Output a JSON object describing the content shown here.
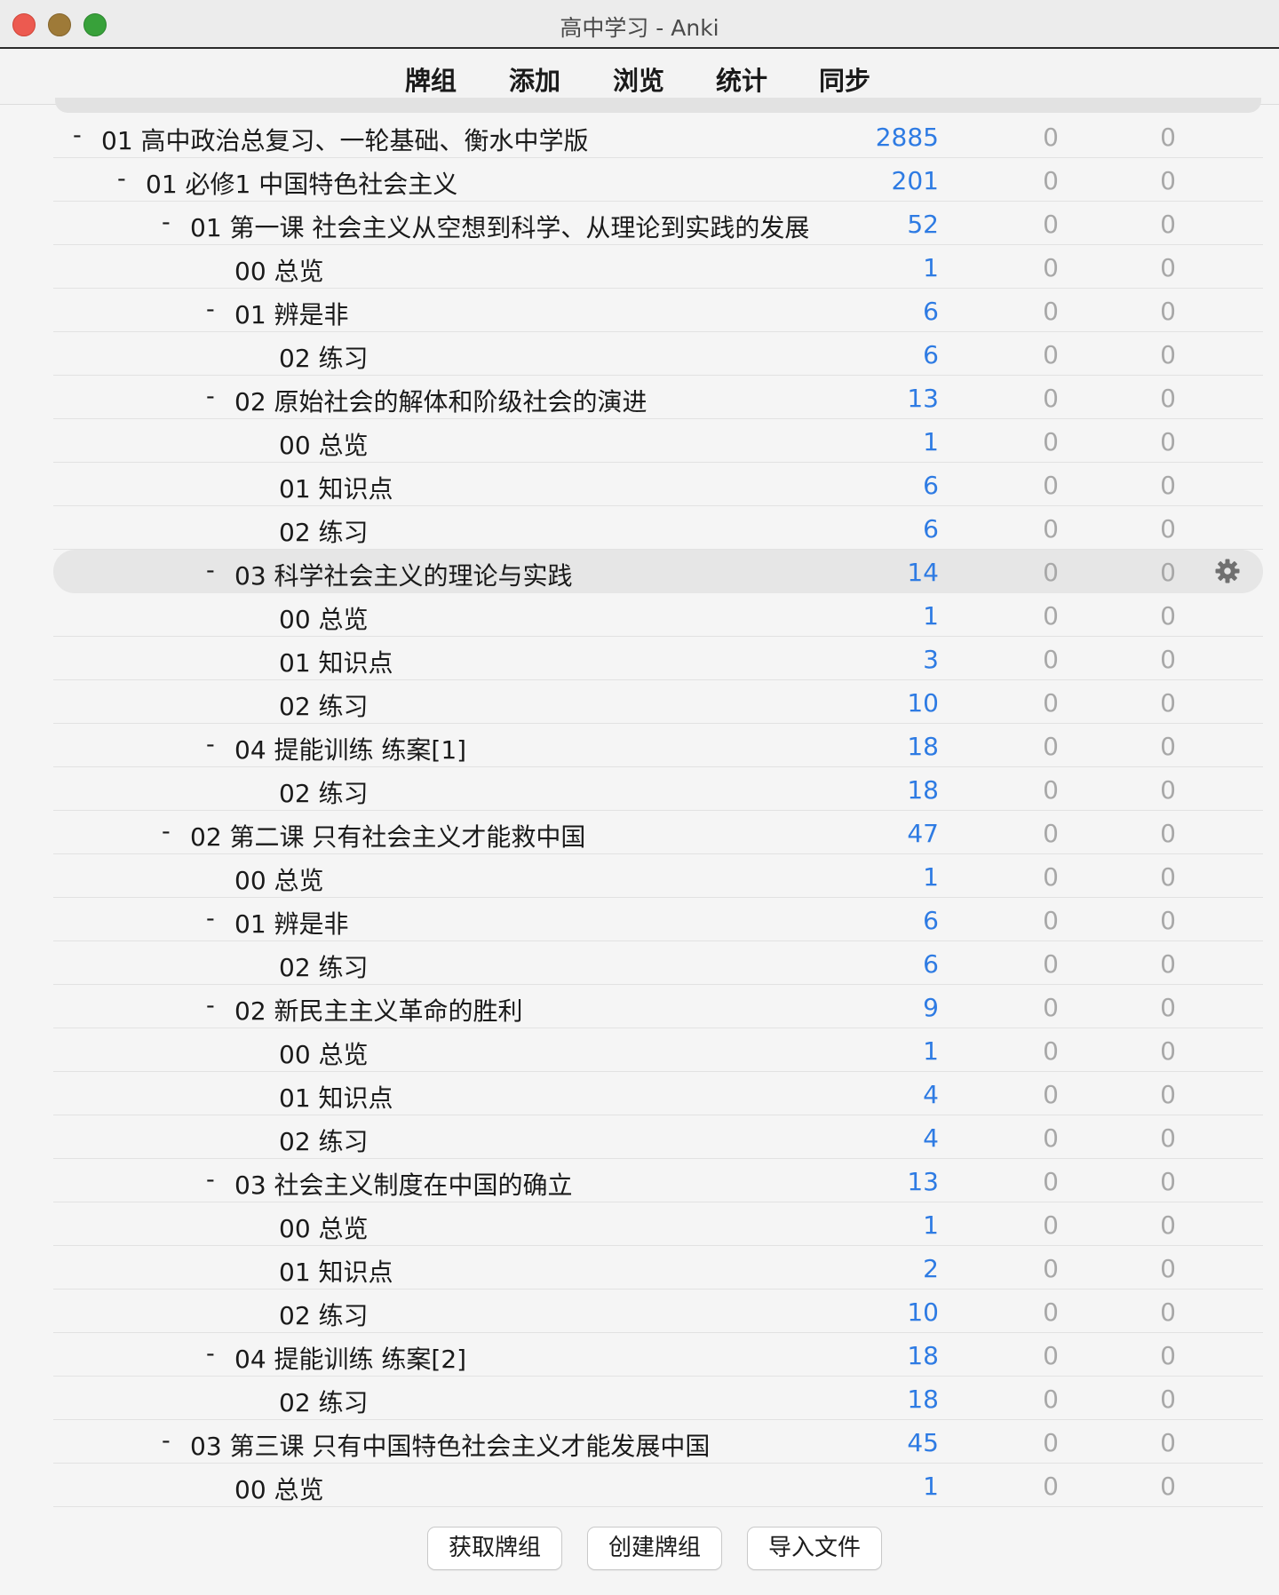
{
  "window": {
    "title": "高中学习 - Anki"
  },
  "toolbar": {
    "decks": "牌组",
    "add": "添加",
    "browse": "浏览",
    "stats": "统计",
    "sync": "同步"
  },
  "decks": [
    {
      "name": "01 高中政治总复习、一轮基础、衡水中学版",
      "level": 0,
      "expanded": true,
      "new": "2885",
      "learn": "0",
      "due": "0"
    },
    {
      "name": "01 必修1 中国特色社会主义",
      "level": 1,
      "expanded": true,
      "new": "201",
      "learn": "0",
      "due": "0"
    },
    {
      "name": "01 第一课 社会主义从空想到科学、从理论到实践的发展",
      "level": 2,
      "expanded": true,
      "new": "52",
      "learn": "0",
      "due": "0"
    },
    {
      "name": "00 总览",
      "level": 3,
      "expanded": false,
      "new": "1",
      "learn": "0",
      "due": "0"
    },
    {
      "name": "01 辨是非",
      "level": 3,
      "expanded": true,
      "new": "6",
      "learn": "0",
      "due": "0"
    },
    {
      "name": "02 练习",
      "level": 4,
      "expanded": false,
      "new": "6",
      "learn": "0",
      "due": "0"
    },
    {
      "name": "02 原始社会的解体和阶级社会的演进",
      "level": 3,
      "expanded": true,
      "new": "13",
      "learn": "0",
      "due": "0"
    },
    {
      "name": "00 总览",
      "level": 4,
      "expanded": false,
      "new": "1",
      "learn": "0",
      "due": "0"
    },
    {
      "name": "01 知识点",
      "level": 4,
      "expanded": false,
      "new": "6",
      "learn": "0",
      "due": "0"
    },
    {
      "name": "02 练习",
      "level": 4,
      "expanded": false,
      "new": "6",
      "learn": "0",
      "due": "0"
    },
    {
      "name": "03 科学社会主义的理论与实践",
      "level": 3,
      "expanded": true,
      "selected": true,
      "new": "14",
      "learn": "0",
      "due": "0"
    },
    {
      "name": "00 总览",
      "level": 4,
      "expanded": false,
      "new": "1",
      "learn": "0",
      "due": "0"
    },
    {
      "name": "01 知识点",
      "level": 4,
      "expanded": false,
      "new": "3",
      "learn": "0",
      "due": "0"
    },
    {
      "name": "02 练习",
      "level": 4,
      "expanded": false,
      "new": "10",
      "learn": "0",
      "due": "0"
    },
    {
      "name": "04 提能训练 练案[1]",
      "level": 3,
      "expanded": true,
      "new": "18",
      "learn": "0",
      "due": "0"
    },
    {
      "name": "02 练习",
      "level": 4,
      "expanded": false,
      "new": "18",
      "learn": "0",
      "due": "0"
    },
    {
      "name": "02 第二课 只有社会主义才能救中国",
      "level": 2,
      "expanded": true,
      "new": "47",
      "learn": "0",
      "due": "0"
    },
    {
      "name": "00 总览",
      "level": 3,
      "expanded": false,
      "new": "1",
      "learn": "0",
      "due": "0"
    },
    {
      "name": "01 辨是非",
      "level": 3,
      "expanded": true,
      "new": "6",
      "learn": "0",
      "due": "0"
    },
    {
      "name": "02 练习",
      "level": 4,
      "expanded": false,
      "new": "6",
      "learn": "0",
      "due": "0"
    },
    {
      "name": "02 新民主主义革命的胜利",
      "level": 3,
      "expanded": true,
      "new": "9",
      "learn": "0",
      "due": "0"
    },
    {
      "name": "00 总览",
      "level": 4,
      "expanded": false,
      "new": "1",
      "learn": "0",
      "due": "0"
    },
    {
      "name": "01 知识点",
      "level": 4,
      "expanded": false,
      "new": "4",
      "learn": "0",
      "due": "0"
    },
    {
      "name": "02 练习",
      "level": 4,
      "expanded": false,
      "new": "4",
      "learn": "0",
      "due": "0"
    },
    {
      "name": "03 社会主义制度在中国的确立",
      "level": 3,
      "expanded": true,
      "new": "13",
      "learn": "0",
      "due": "0"
    },
    {
      "name": "00 总览",
      "level": 4,
      "expanded": false,
      "new": "1",
      "learn": "0",
      "due": "0"
    },
    {
      "name": "01 知识点",
      "level": 4,
      "expanded": false,
      "new": "2",
      "learn": "0",
      "due": "0"
    },
    {
      "name": "02 练习",
      "level": 4,
      "expanded": false,
      "new": "10",
      "learn": "0",
      "due": "0"
    },
    {
      "name": "04 提能训练 练案[2]",
      "level": 3,
      "expanded": true,
      "new": "18",
      "learn": "0",
      "due": "0"
    },
    {
      "name": "02 练习",
      "level": 4,
      "expanded": false,
      "new": "18",
      "learn": "0",
      "due": "0"
    },
    {
      "name": "03 第三课 只有中国特色社会主义才能发展中国",
      "level": 2,
      "expanded": true,
      "new": "45",
      "learn": "0",
      "due": "0"
    },
    {
      "name": "00 总览",
      "level": 3,
      "expanded": false,
      "new": "1",
      "learn": "0",
      "due": "0"
    }
  ],
  "collapse_symbol": "-",
  "buttons": {
    "get_shared": "获取牌组",
    "create_deck": "创建牌组",
    "import_file": "导入文件"
  },
  "colors": {
    "new_count": "#2e7be3",
    "zero_count": "#a8a8a8",
    "selected_row": "#e6e6e6"
  }
}
